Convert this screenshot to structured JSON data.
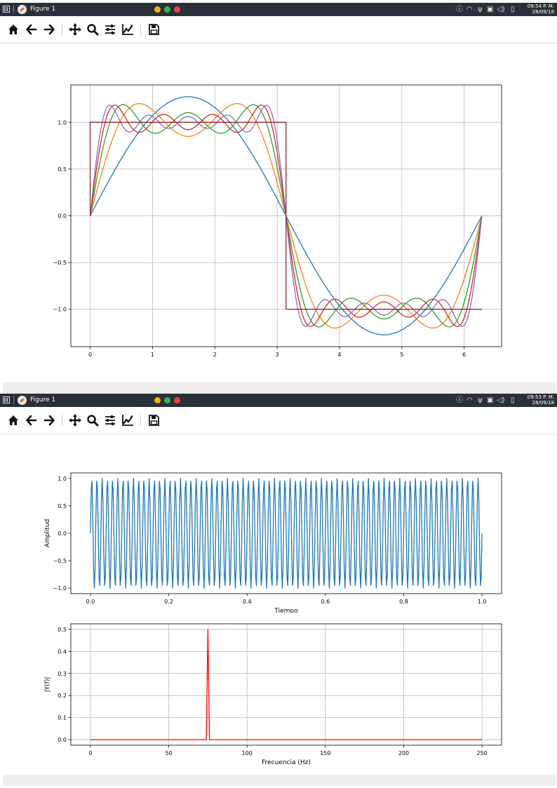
{
  "windows": [
    {
      "title": "Figure 1",
      "clock_time": "09:54 P. M.",
      "clock_date": "28/09/18"
    },
    {
      "title": "Figure 1",
      "clock_time": "09:53 P. M.",
      "clock_date": "28/09/18"
    }
  ],
  "window_controls": {
    "minimize_color": "#f4b400",
    "maximize_color": "#2dbb4e",
    "close_color": "#e9424a"
  },
  "toolbar_icons": [
    "home-icon",
    "back-arrow-icon",
    "forward-arrow-icon",
    "pan-icon",
    "zoom-icon",
    "subplots-configure-icon",
    "edit-axes-icon",
    "save-icon"
  ],
  "tray_icons": [
    "info-icon",
    "wifi-icon",
    "usb-icon",
    "clipboard-icon",
    "volume-icon",
    "battery-icon"
  ],
  "chart_data": [
    {
      "type": "line",
      "title": "",
      "xlabel": "",
      "ylabel": "",
      "xlim": [
        -0.31,
        6.6
      ],
      "ylim": [
        -1.4,
        1.4
      ],
      "xticks": [
        0,
        1,
        2,
        3,
        4,
        5,
        6
      ],
      "xticklabels": [
        "0",
        "1",
        "2",
        "3",
        "4",
        "5",
        "6"
      ],
      "yticks": [
        1.0,
        0.5,
        0.0,
        -0.5,
        -1.0
      ],
      "yticklabels": [
        "1.0",
        "0.5",
        "0.0",
        "−0.5",
        "−1.0"
      ],
      "grid": true,
      "x_range": [
        0,
        6.283
      ],
      "series": [
        {
          "kind": "fourier_partial_sum",
          "terms": 1,
          "color": "#1f77b4",
          "peak": 1.27,
          "peak_x": 1.57
        },
        {
          "kind": "fourier_partial_sum",
          "terms": 2,
          "color": "#ff7f0e",
          "peak": 1.2,
          "dip": 0.85
        },
        {
          "kind": "fourier_partial_sum",
          "terms": 3,
          "color": "#2ca02c",
          "peak": 1.19,
          "dip": 0.9
        },
        {
          "kind": "fourier_partial_sum",
          "terms": 4,
          "color": "#d62728",
          "peak": 1.09,
          "dip": 0.94
        },
        {
          "kind": "fourier_partial_sum",
          "terms": 5,
          "color": "#9467bd",
          "peak": 1.18,
          "dip": 0.93
        },
        {
          "kind": "square_wave",
          "color": "#8c2b2b",
          "high": 1.0,
          "low": -1.0,
          "switch_x": 3.1416
        }
      ]
    },
    {
      "type": "line",
      "title": "",
      "xlabel": "Tiempo",
      "ylabel": "Amplitud",
      "xlim": [
        -0.05,
        1.05
      ],
      "ylim": [
        -1.1,
        1.1
      ],
      "xticks": [
        0.0,
        0.2,
        0.4,
        0.6,
        0.8,
        1.0
      ],
      "xticklabels": [
        "0.0",
        "0.2",
        "0.4",
        "0.6",
        "0.8",
        "1.0"
      ],
      "yticks": [
        1.0,
        0.5,
        0.0,
        -0.5,
        -1.0
      ],
      "yticklabels": [
        "1.0",
        "0.5",
        "0.0",
        "−0.5",
        "−1.0"
      ],
      "grid": false,
      "series": [
        {
          "kind": "sine",
          "frequency_hz": 75,
          "amplitude": 1.0,
          "sample_rate": 500,
          "x_start": 0.0,
          "x_end": 1.0,
          "color": "#1f77b4"
        }
      ]
    },
    {
      "type": "line",
      "title": "",
      "xlabel": "Frecuencia (Hz)",
      "ylabel": "|Y(f)|",
      "xlim": [
        -12.5,
        262.5
      ],
      "ylim": [
        -0.025,
        0.525
      ],
      "xticks": [
        0,
        50,
        100,
        150,
        200,
        250
      ],
      "xticklabels": [
        "0",
        "50",
        "100",
        "150",
        "200",
        "250"
      ],
      "yticks": [
        0.5,
        0.4,
        0.3,
        0.2,
        0.1,
        0.0
      ],
      "yticklabels": [
        "0.5",
        "0.4",
        "0.3",
        "0.2",
        "0.1",
        "0.0"
      ],
      "grid": true,
      "series": [
        {
          "kind": "spectrum",
          "x": [
            0,
            74,
            75,
            76,
            250
          ],
          "y": [
            0.0,
            0.0,
            0.5,
            0.0,
            0.0
          ],
          "color": "#ff0000"
        }
      ]
    }
  ]
}
